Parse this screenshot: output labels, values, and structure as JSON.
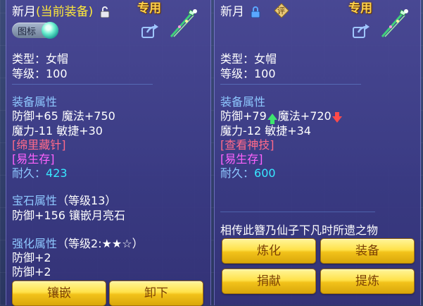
{
  "left": {
    "name": "新月",
    "equip_tag": "(当前装备)",
    "zhuan": "专用",
    "badge_label": "图标",
    "type_line": "类型：女帽",
    "level_line": "等级：100",
    "attr_header": "装备属性",
    "attr_line1": "防御+65 魔法+750",
    "attr_line2": "魔力-11 敏捷+30",
    "special": "[绵里藏针]",
    "survival": "[易生存]",
    "durability_label": "耐久：",
    "durability_value": "423",
    "gem_header": "宝石属性",
    "gem_level": "（等级13）",
    "gem_line": "防御+156 镶嵌月亮石",
    "enhance_header": "强化属性",
    "enhance_level": "（等级2:★★☆）",
    "enhance_line1": "防御+2",
    "enhance_line2": "防御+2",
    "buttons": {
      "inlay": "镶嵌",
      "unequip": "卸下"
    }
  },
  "right": {
    "name": "新月",
    "badge_label": "评",
    "zhuan": "专用",
    "type_line": "类型：女帽",
    "level_line": "等级：100",
    "attr_header": "装备属性",
    "attr_defense": "防御+79",
    "attr_magic": "魔法+720",
    "attr_line2": "魔力-12 敏捷+34",
    "special": "[查看神技]",
    "survival": "[易生存]",
    "durability_label": "耐久：",
    "durability_value": "600",
    "description": "相传此簪乃仙子下凡时所遗之物",
    "buttons": {
      "refine": "炼化",
      "equip": "装备",
      "donate": "捐献",
      "extract": "提炼"
    }
  },
  "colors": {
    "panel_bg": "#48489a",
    "label_blue": "#8ec8ff",
    "value_cyan": "#37e8ff",
    "special_red": "#ff6a8a",
    "survival_magenta": "#ff62ff",
    "equip_tag_yellow": "#ffe93a",
    "button_gold": "#ffe24a"
  },
  "icons": [
    "padlock-open-icon",
    "padlock-closed-icon",
    "share-icon",
    "gem-orb-icon",
    "hairpin-item-icon",
    "appraise-badge-icon",
    "arrow-up-icon",
    "arrow-down-icon"
  ]
}
